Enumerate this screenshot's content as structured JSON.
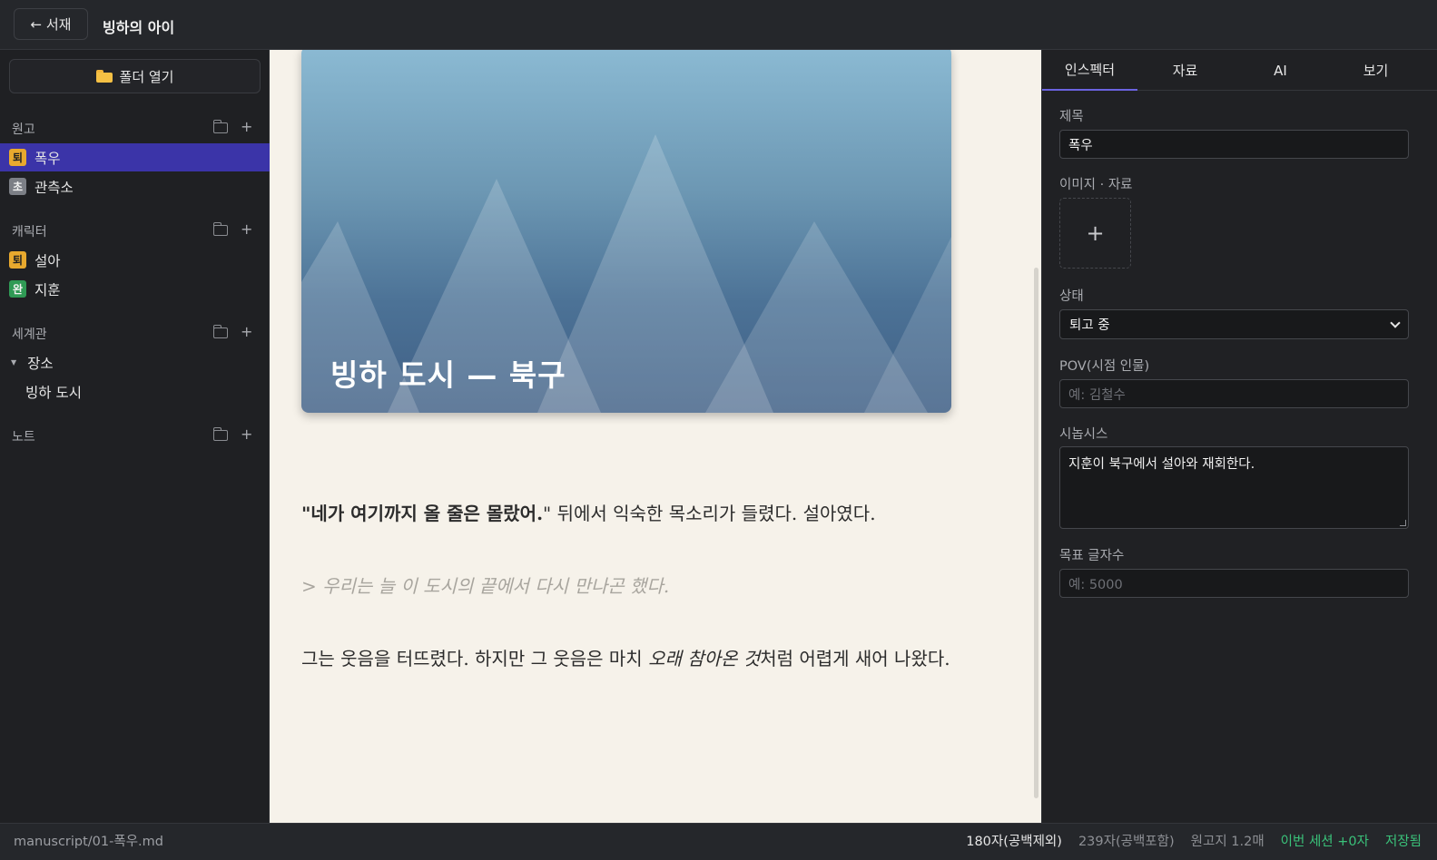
{
  "topbar": {
    "back_label": "← 서재",
    "book_title": "빙하의 아이"
  },
  "sidebar": {
    "open_folder_label": "폴더 열기",
    "sections": [
      {
        "title": "원고",
        "items": [
          {
            "badge": "퇴",
            "badge_color": "#e8a92e",
            "label": "폭우",
            "active": true
          },
          {
            "badge": "초",
            "badge_color": "#7c7f86",
            "label": "관측소",
            "active": false
          }
        ]
      },
      {
        "title": "캐릭터",
        "items": [
          {
            "badge": "퇴",
            "badge_color": "#e8a92e",
            "label": "설아"
          },
          {
            "badge": "완",
            "badge_color": "#2f9a55",
            "label": "지훈"
          }
        ]
      },
      {
        "title": "세계관",
        "tree": {
          "parent": "장소",
          "child": "빙하 도시"
        }
      },
      {
        "title": "노트"
      }
    ]
  },
  "editor": {
    "hero_title": "빙하 도시 — 북구",
    "para1_open": "\"",
    "para1_bold": "네가 여기까지 올 줄은 몰랐어.",
    "para1_rest": "\" 뒤에서 익숙한 목소리가 들렸다. 설아였다.",
    "blockquote": "> 우리는 늘 이 도시의 끝에서 다시 만나곤 했다.",
    "para2_a": "그는 웃음을 터뜨렸다. 하지만 그 웃음은 마치 ",
    "para2_em": "오래 참아온 것",
    "para2_b": "처럼 어렵게 새어 나왔다."
  },
  "panel": {
    "tabs": [
      "인스펙터",
      "자료",
      "AI",
      "보기"
    ],
    "active_tab": "인스펙터",
    "title_label": "제목",
    "title_value": "폭우",
    "images_label": "이미지 · 자료",
    "add_symbol": "+",
    "status_label": "상태",
    "status_value": "퇴고 중",
    "pov_label": "POV(시점 인물)",
    "pov_placeholder": "예: 김철수",
    "synopsis_label": "시놉시스",
    "synopsis_value": "지훈이 북구에서 설아와 재회한다.",
    "target_label": "목표 글자수",
    "target_placeholder": "예: 5000"
  },
  "statusbar": {
    "path": "manuscript/01-폭우.md",
    "chars_no_space": "180자(공백제외)",
    "chars_with_space": "239자(공백포함)",
    "manuscript_pages": "원고지 1.2매",
    "session": "이번 세션 +0자",
    "saved": "저장됨"
  },
  "colors": {
    "accent": "#3b34a8",
    "tab_underline": "#6b63e0",
    "status_green": "#3ac27a",
    "editor_bg": "#f6f2ea"
  }
}
